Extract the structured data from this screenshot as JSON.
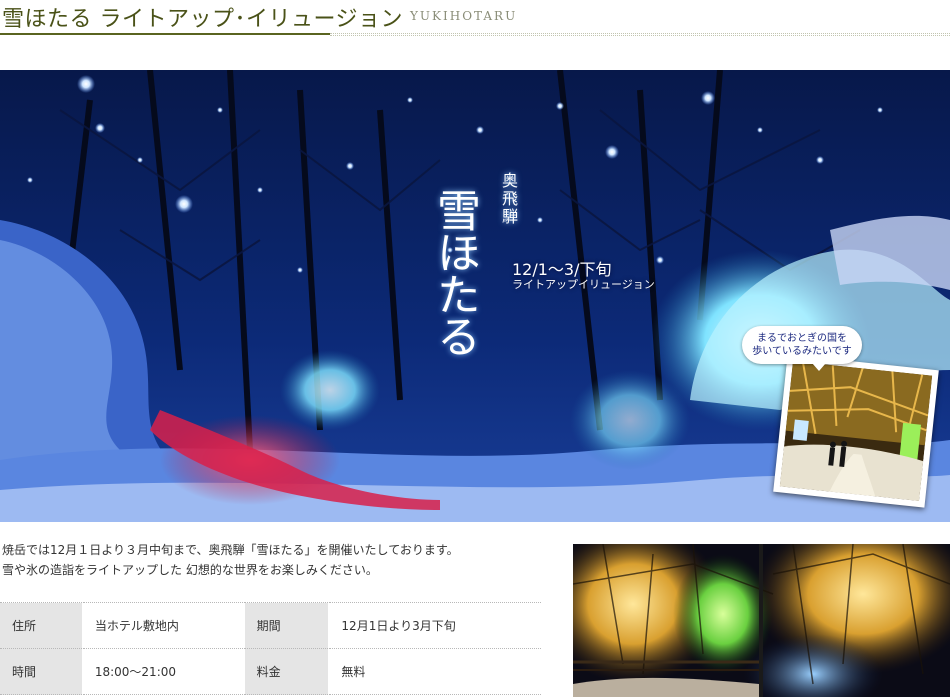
{
  "header": {
    "title": "雪ほたる ライトアップ･イリュージョン",
    "subtitle": "YUKIHOTARU"
  },
  "hero": {
    "region": "奥飛騨",
    "name": "雪ほたる",
    "dates": "12/1〜3/下旬",
    "event": "ライトアップイリュージョン",
    "bubble_line1": "まるでおとぎの国を",
    "bubble_line2": "歩いているみたいです"
  },
  "intro": {
    "line1": "焼岳では12月１日より３月中旬まで、奥飛騨「雪ほたる」を開催いたしております。",
    "line2": "雪や氷の造詣をライトアップした 幻想的な世界をお楽しみください。"
  },
  "info": {
    "address_label": "住所",
    "address_value": "当ホテル敷地内",
    "period_label": "期間",
    "period_value": "12月1日より3月下旬",
    "time_label": "時間",
    "time_value": "18:00〜21:00",
    "fee_label": "料金",
    "fee_value": "無料"
  },
  "colors": {
    "title": "#4a5218",
    "rule": "#5a6420",
    "night": "#071a4e",
    "ice": "#7fe3ff",
    "red_light": "#d8204a",
    "table_label_bg": "#e5e5e5"
  }
}
